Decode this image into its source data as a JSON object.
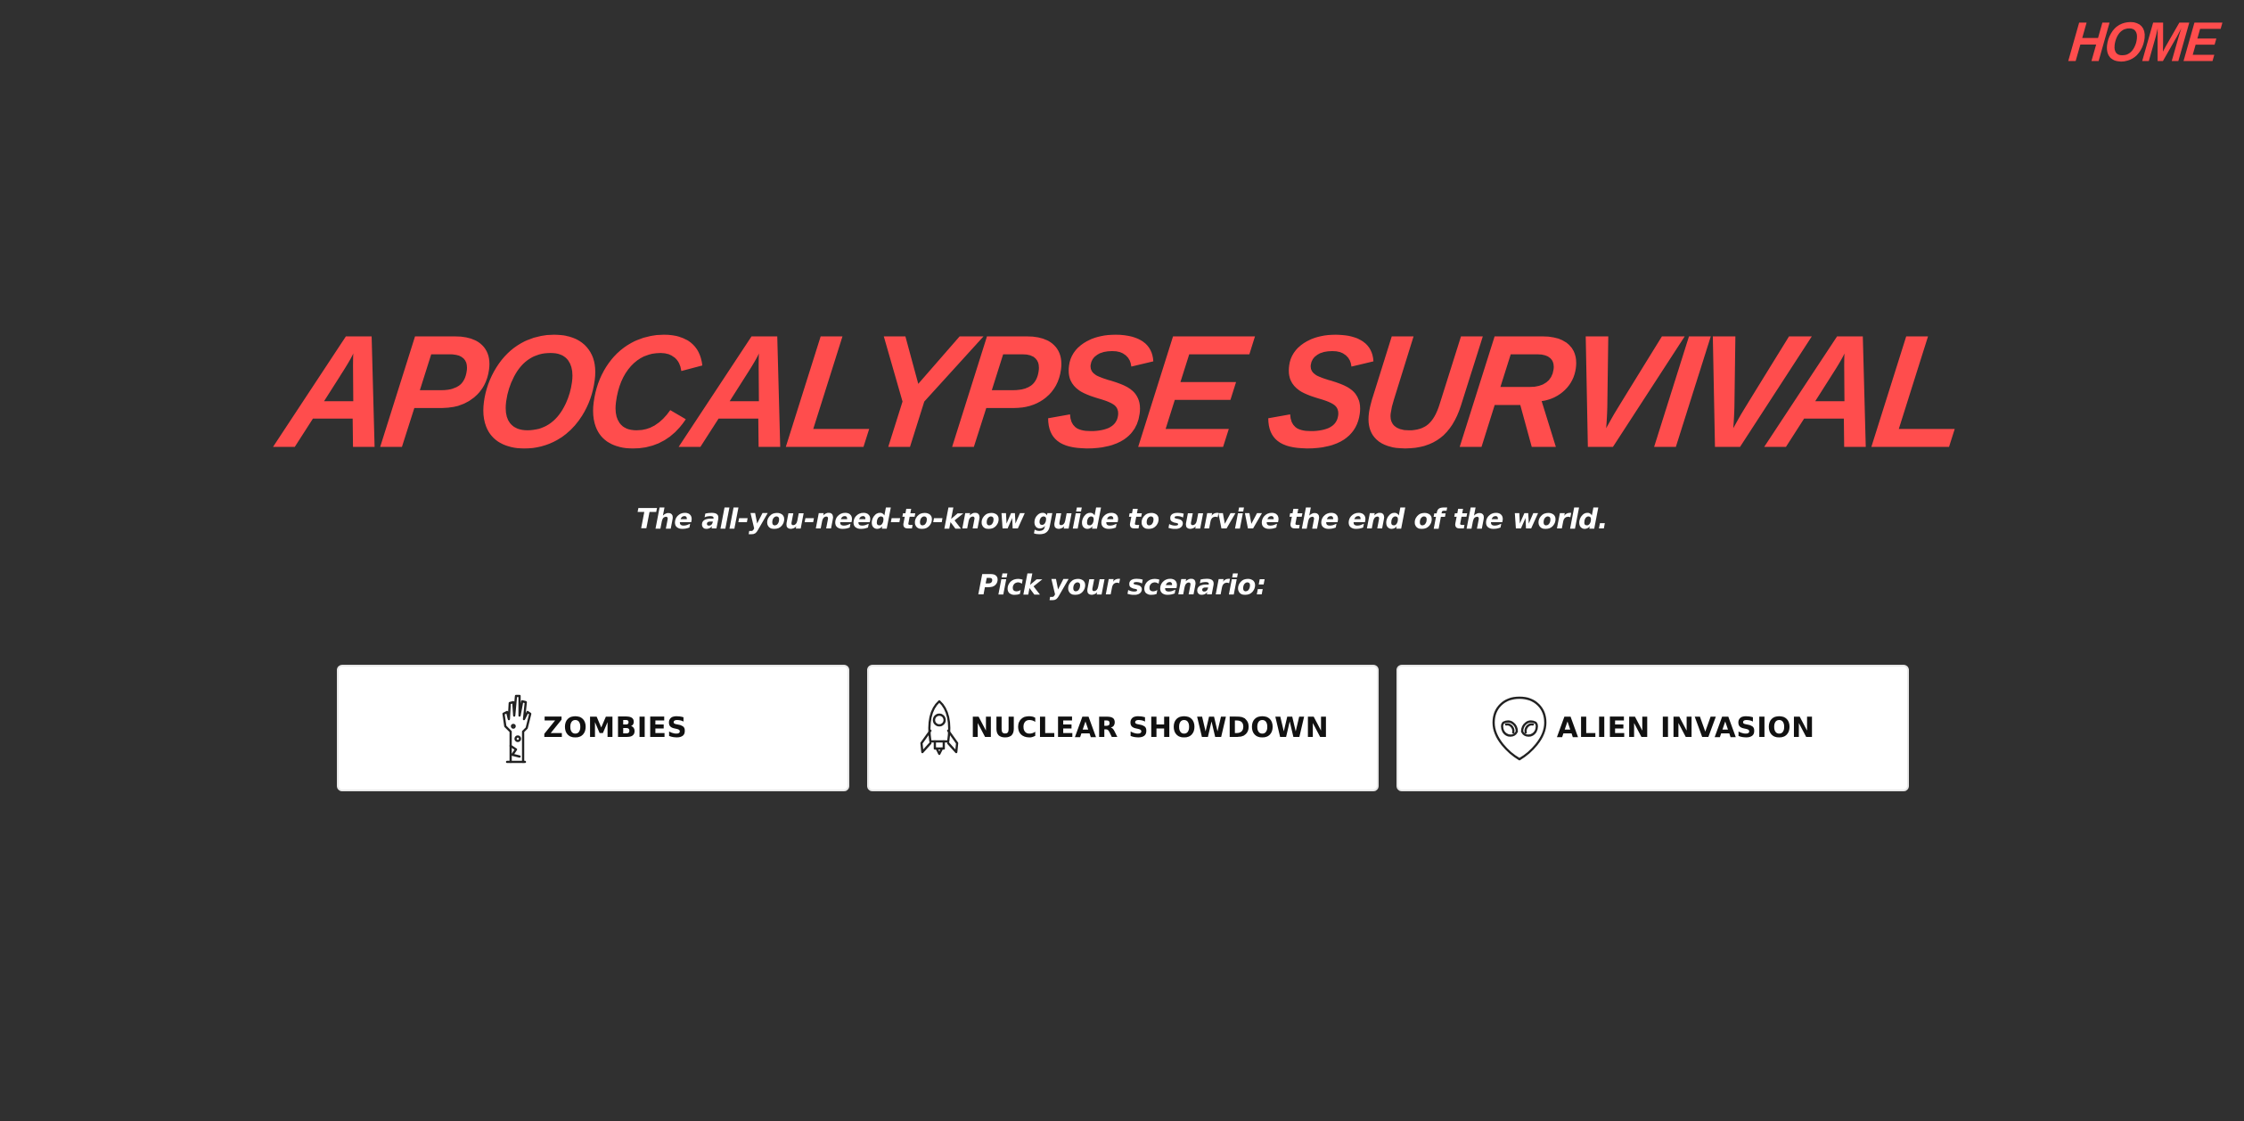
{
  "nav": {
    "home_label": "HOME"
  },
  "hero": {
    "title": "APOCALYPSE SURVIVAL",
    "subtitle": "The all-you-need-to-know guide to survive the end of the world.",
    "prompt": "Pick your scenario:"
  },
  "scenarios": [
    {
      "label": "ZOMBIES",
      "icon": "zombie-hand-icon"
    },
    {
      "label": "NUCLEAR SHOWDOWN",
      "icon": "rocket-icon"
    },
    {
      "label": "ALIEN INVASION",
      "icon": "alien-head-icon"
    }
  ],
  "colors": {
    "background": "#303030",
    "accent": "#ff4d4d",
    "text_light": "#ffffff",
    "card_background": "#ffffff",
    "card_text": "#111111"
  }
}
